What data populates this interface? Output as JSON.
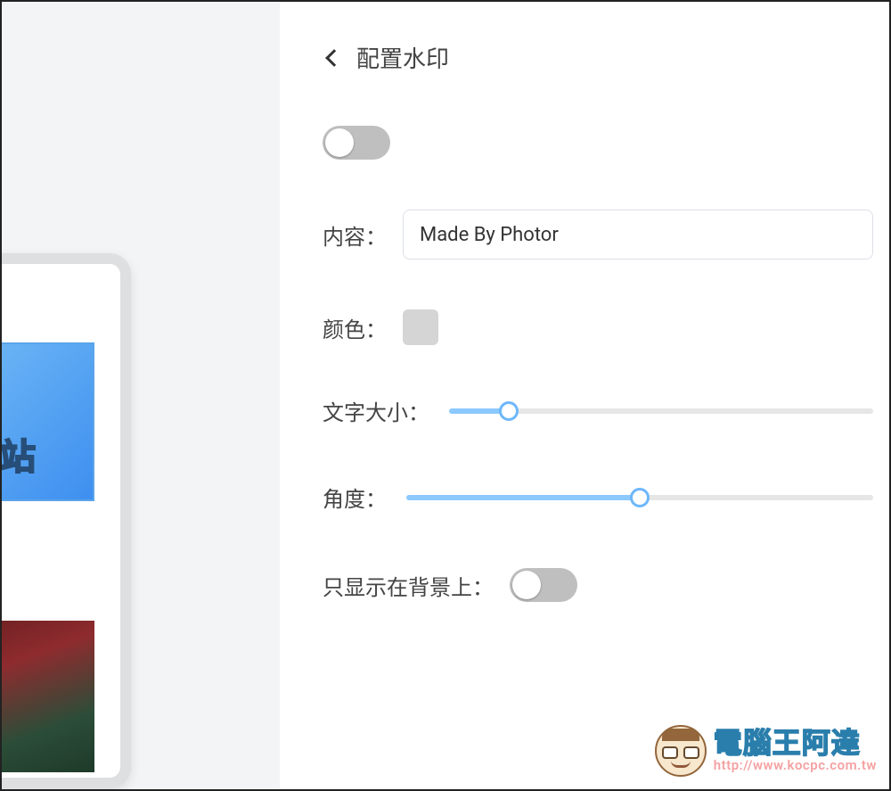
{
  "header": {
    "title": "配置水印"
  },
  "watermark": {
    "enabled": false,
    "content_label": "内容：",
    "content_value": "Made By Photor",
    "color_label": "颜色：",
    "color_hex": "#d5d5d5",
    "font_size_label": "文字大小：",
    "font_size_pct": 14,
    "angle_label": "角度：",
    "angle_pct": 50,
    "bg_only_label": "只显示在背景上：",
    "bg_only_enabled": false
  },
  "preview": {
    "tile_text": "周站"
  },
  "brand": {
    "name_cn": "電腦王阿達",
    "url_text": "http://www.kocpc.com.tw"
  }
}
